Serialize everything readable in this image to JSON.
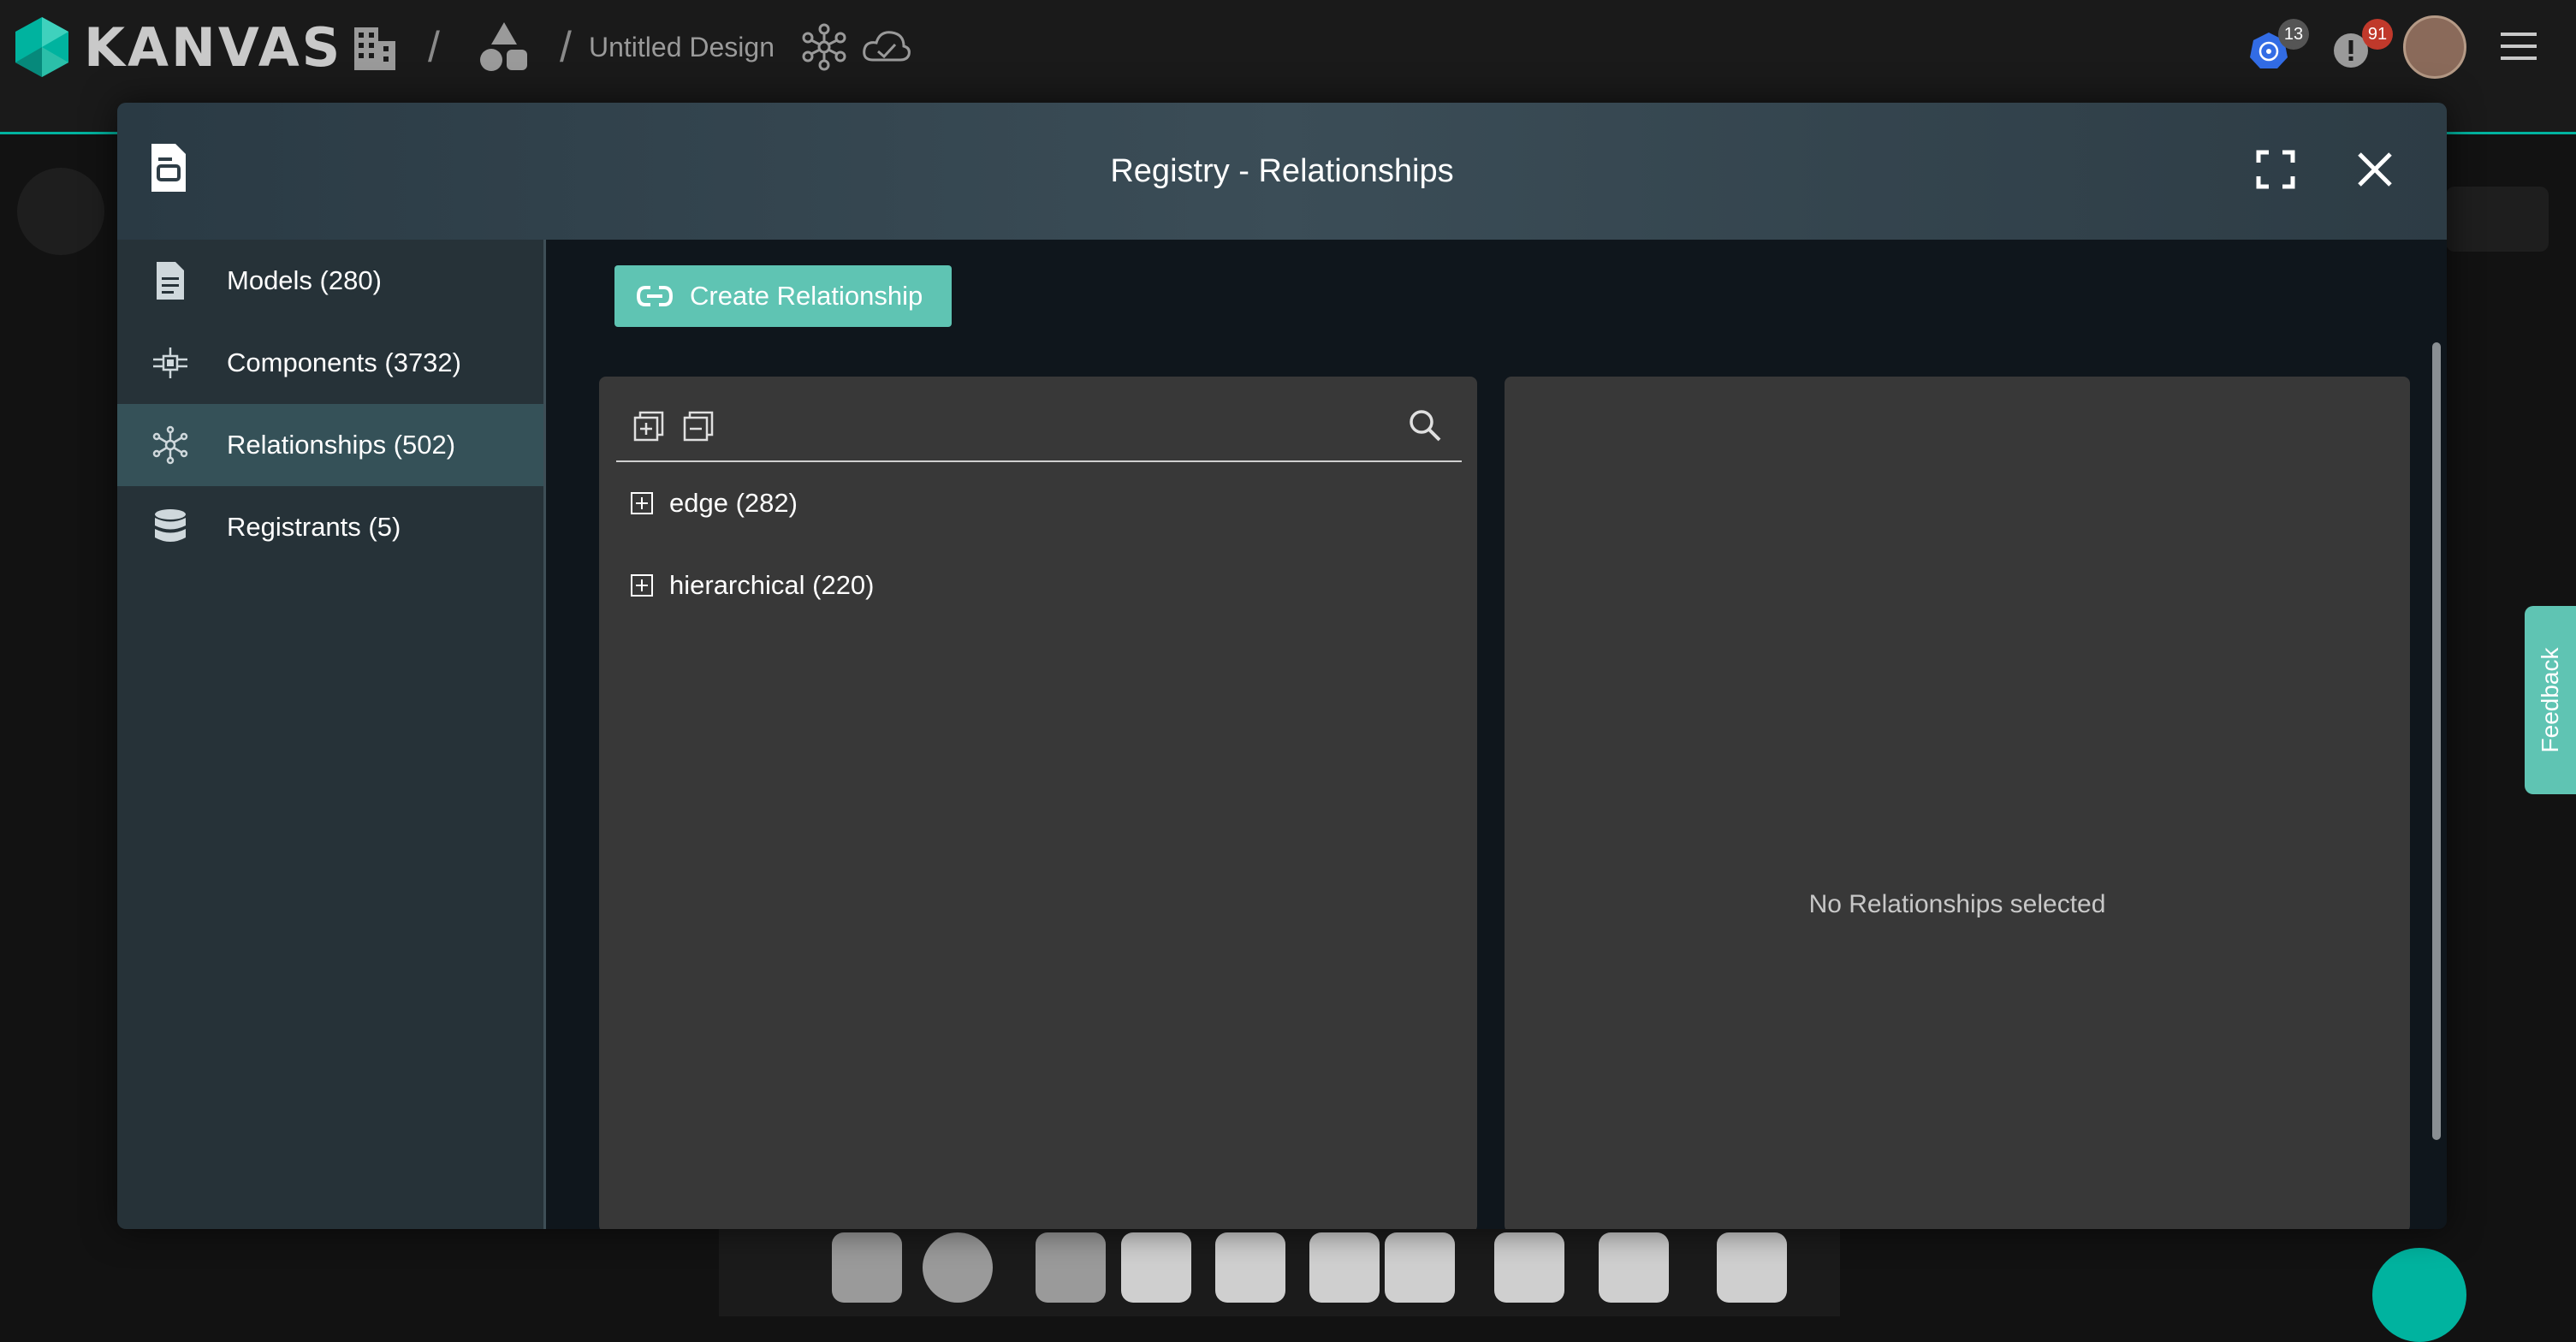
{
  "app": {
    "brand": "KANVAS"
  },
  "topbar": {
    "design_title": "Untitled Design",
    "kubernetes_badge": "13",
    "notifications_badge": "91",
    "icons": [
      "kanvas-logo",
      "building-icon",
      "shapes-icon",
      "cluster-icon",
      "cloud-icon",
      "kubernetes-icon",
      "alert-icon",
      "avatar",
      "menu-icon"
    ]
  },
  "modal": {
    "title": "Registry - Relationships",
    "sidebar": {
      "items": [
        {
          "label": "Models (280)",
          "icon": "document-icon",
          "active": false
        },
        {
          "label": "Components (3732)",
          "icon": "component-icon",
          "active": false
        },
        {
          "label": "Relationships (502)",
          "icon": "relationship-icon",
          "active": true
        },
        {
          "label": "Registrants (5)",
          "icon": "database-icon",
          "active": false
        }
      ]
    },
    "create_button": "Create Relationship",
    "tree": [
      {
        "label": "edge (282)"
      },
      {
        "label": "hierarchical (220)"
      }
    ],
    "empty_message": "No Relationships selected"
  },
  "feedback": {
    "label": "Feedback"
  },
  "colors": {
    "accent": "#00b39f",
    "button": "#5fc4b3",
    "header": "#3b4d57",
    "sidebar": "#263238",
    "panel": "#383838"
  }
}
